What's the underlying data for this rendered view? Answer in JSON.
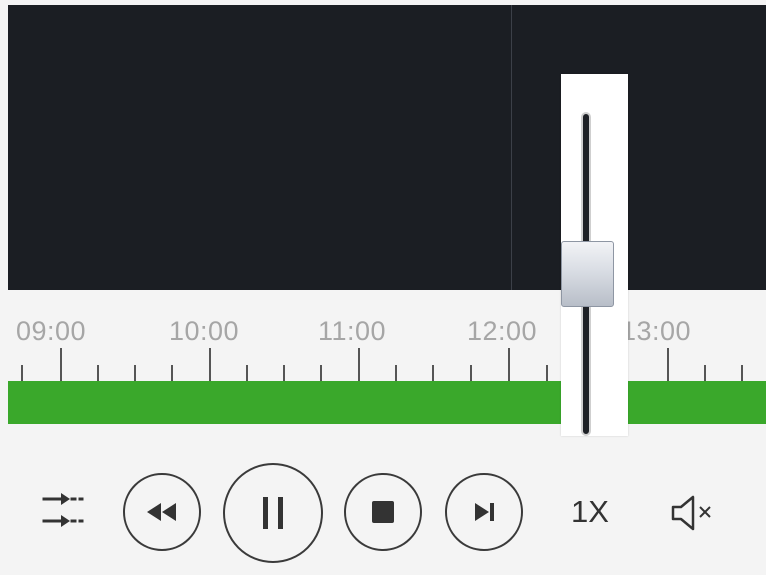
{
  "timeline": {
    "times": [
      "09:00",
      "10:00",
      "11:00",
      "12:00",
      "13:00"
    ]
  },
  "player": {
    "speed_label": "1X",
    "playback_state": "playing",
    "muted": true
  },
  "icons": {
    "settings": "sliders-icon",
    "rewind": "rewind-icon",
    "pause": "pause-icon",
    "stop": "stop-icon",
    "next_frame": "step-forward-icon",
    "volume": "volume-muted-icon"
  },
  "colors": {
    "recording_bar": "#3aa82b",
    "video_bg": "#1b1e23"
  }
}
